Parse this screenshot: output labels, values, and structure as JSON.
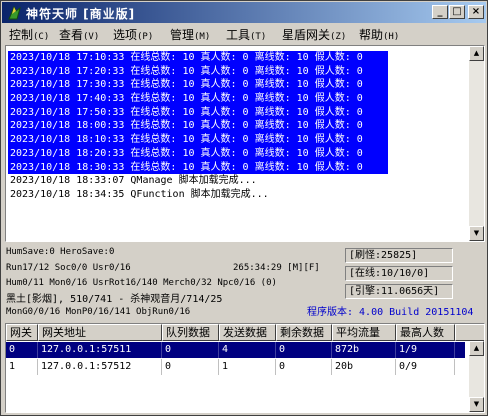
{
  "window": {
    "title": "神符天师 [商业版]"
  },
  "menu": [
    {
      "label": "控制",
      "mnemonic": "(C)"
    },
    {
      "label": "查看",
      "mnemonic": "(V)"
    },
    {
      "label": "选项",
      "mnemonic": "(P)"
    },
    {
      "label": "管理",
      "mnemonic": "(M)"
    },
    {
      "label": "工具",
      "mnemonic": "(T)"
    },
    {
      "label": "星盾网关",
      "mnemonic": "(Z)"
    },
    {
      "label": "帮助",
      "mnemonic": "(H)"
    }
  ],
  "log": [
    "2023/10/18 17:10:33 在线总数: 10 真人数: 0 离线数: 10 假人数: 0",
    "2023/10/18 17:20:33 在线总数: 10 真人数: 0 离线数: 10 假人数: 0",
    "2023/10/18 17:30:33 在线总数: 10 真人数: 0 离线数: 10 假人数: 0",
    "2023/10/18 17:40:33 在线总数: 10 真人数: 0 离线数: 10 假人数: 0",
    "2023/10/18 17:50:33 在线总数: 10 真人数: 0 离线数: 10 假人数: 0",
    "2023/10/18 18:00:33 在线总数: 10 真人数: 0 离线数: 10 假人数: 0",
    "2023/10/18 18:10:33 在线总数: 10 真人数: 0 离线数: 10 假人数: 0",
    "2023/10/18 18:20:33 在线总数: 10 真人数: 0 离线数: 10 假人数: 0",
    "2023/10/18 18:30:33 在线总数: 10 真人数: 0 离线数: 10 假人数: 0",
    "2023/10/18 18:33:07 QManage 脚本加载完成...",
    "2023/10/18 18:34:35 QFunction 脚本加载完成..."
  ],
  "status": {
    "line1": "HumSave:0 HeroSave:0",
    "line2": "Run17/12 Soc0/0 Usr0/16",
    "uptime": "265:34:29 [M][F]",
    "line3": "Hum0/11 Mon0/16 UsrRot16/140 Merch0/32 Npc0/16 (0)",
    "line4": "黑土[影烟], 510/741 - 杀神观音月/714/25",
    "line5": "MonG0/0/16 MonP0/16/141 ObjRun0/16",
    "refresh": "[刷怪:25825]",
    "online": "[在线:10/10/0]",
    "quote": "[引擎:11.0656天]",
    "version": "程序版本: 4.00 Build 20151104"
  },
  "table": {
    "headers": [
      "网关",
      "网关地址",
      "队列数据",
      "发送数据",
      "剩余数据",
      "平均流量",
      "最高人数"
    ],
    "rows": [
      [
        "0",
        "127.0.0.1:57511",
        "0",
        "4",
        "0",
        "872b",
        "1/9"
      ],
      [
        "1",
        "127.0.0.1:57512",
        "0",
        "1",
        "0",
        "20b",
        "0/9"
      ]
    ]
  }
}
